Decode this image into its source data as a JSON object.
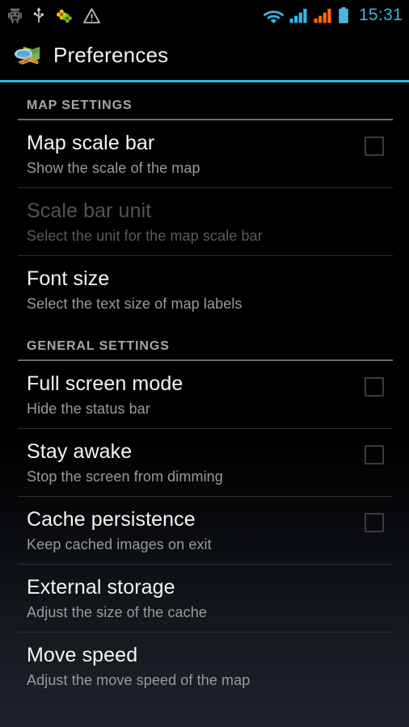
{
  "status_bar": {
    "time": "15:31",
    "left_icons": [
      {
        "name": "android-debug-icon",
        "label": "Android debug"
      },
      {
        "name": "usb-icon",
        "label": "USB connected"
      },
      {
        "name": "flower-icon",
        "label": "Sync active"
      },
      {
        "name": "warning-triangle-icon",
        "label": "Warning"
      }
    ],
    "right_icons": [
      {
        "name": "wifi-icon",
        "label": "Wi-Fi"
      },
      {
        "name": "signal-bars-icon-1",
        "label": "Mobile signal 1"
      },
      {
        "name": "signal-bars-icon-2",
        "label": "Mobile signal 2"
      },
      {
        "name": "battery-icon",
        "label": "Battery full"
      }
    ],
    "colors": {
      "accent": "#33b5e5",
      "signal_secondary": "#ff6600",
      "background": "#000000"
    }
  },
  "action_bar": {
    "title": "Preferences",
    "icon": "map-app-icon",
    "accent_color": "#33b5e5"
  },
  "sections": [
    {
      "header": "MAP SETTINGS",
      "items": [
        {
          "title": "Map scale bar",
          "summary": "Show the scale of the map",
          "widget": "checkbox",
          "checked": false,
          "enabled": true,
          "divider": true,
          "name": "pref-map-scale-bar"
        },
        {
          "title": "Scale bar unit",
          "summary": "Select the unit for the map scale bar",
          "widget": "none",
          "checked": false,
          "enabled": false,
          "divider": true,
          "name": "pref-scale-bar-unit"
        },
        {
          "title": "Font size",
          "summary": "Select the text size of map labels",
          "widget": "none",
          "checked": false,
          "enabled": true,
          "divider": false,
          "name": "pref-font-size"
        }
      ]
    },
    {
      "header": "GENERAL SETTINGS",
      "items": [
        {
          "title": "Full screen mode",
          "summary": "Hide the status bar",
          "widget": "checkbox",
          "checked": false,
          "enabled": true,
          "divider": true,
          "name": "pref-full-screen-mode"
        },
        {
          "title": "Stay awake",
          "summary": "Stop the screen from dimming",
          "widget": "checkbox",
          "checked": false,
          "enabled": true,
          "divider": true,
          "name": "pref-stay-awake"
        },
        {
          "title": "Cache persistence",
          "summary": "Keep cached images on exit",
          "widget": "checkbox",
          "checked": false,
          "enabled": true,
          "divider": true,
          "name": "pref-cache-persistence"
        },
        {
          "title": "External storage",
          "summary": "Adjust the size of the cache",
          "widget": "none",
          "checked": false,
          "enabled": true,
          "divider": true,
          "name": "pref-external-storage"
        },
        {
          "title": "Move speed",
          "summary": "Adjust the move speed of the map",
          "widget": "none",
          "checked": false,
          "enabled": true,
          "divider": false,
          "name": "pref-move-speed"
        }
      ]
    }
  ]
}
